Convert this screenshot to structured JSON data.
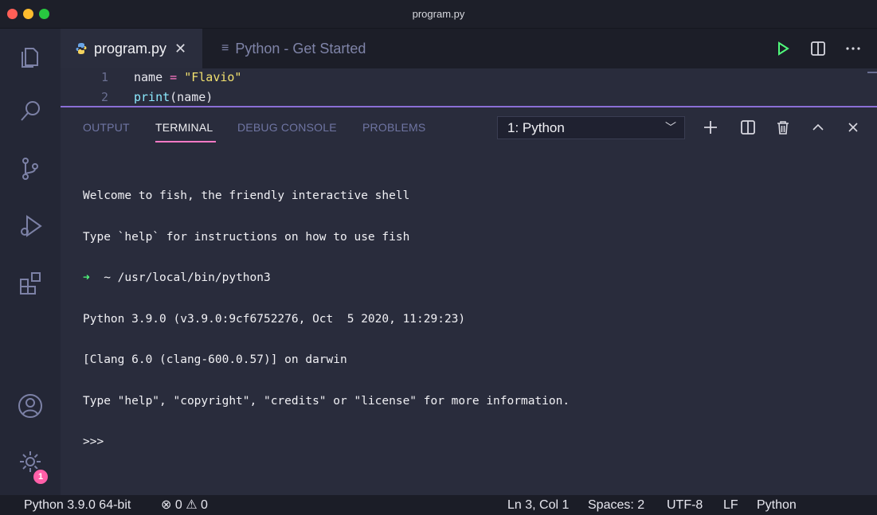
{
  "window": {
    "title": "program.py"
  },
  "tabs": {
    "active": {
      "label": "program.py",
      "close": "✕"
    },
    "inactive": {
      "icon": "≡",
      "label": "Python - Get Started"
    }
  },
  "editor": {
    "lines": [
      {
        "number": "1",
        "parts": [
          "name ",
          "= ",
          "\"Flavio\""
        ]
      },
      {
        "number": "2",
        "parts": [
          "print",
          "(name)"
        ]
      }
    ]
  },
  "panel": {
    "tabs": [
      "OUTPUT",
      "TERMINAL",
      "DEBUG CONSOLE",
      "PROBLEMS"
    ],
    "terminal_select": "1: Python",
    "terminal_lines": [
      "Welcome to fish, the friendly interactive shell",
      "Type `help` for instructions on how to use fish",
      "~ /usr/local/bin/python3",
      "Python 3.9.0 (v3.9.0:9cf6752276, Oct  5 2020, 11:29:23)",
      "[Clang 6.0 (clang-600.0.57)] on darwin",
      "Type \"help\", \"copyright\", \"credits\" or \"license\" for more information.",
      ">>>"
    ],
    "prompt_arrow": "➜"
  },
  "activity": {
    "settings_badge": "1"
  },
  "status": {
    "interpreter": "Python 3.9.0 64-bit",
    "problems": "⊗ 0 ⚠ 0",
    "position": "Ln 3, Col 1",
    "spaces": "Spaces: 2",
    "encoding": "UTF-8",
    "eol": "LF",
    "language": "Python"
  },
  "icons": {
    "explorer": "files-icon",
    "search": "search-icon",
    "scm": "source-control-icon",
    "debug": "run-debug-icon",
    "extensions": "extensions-icon",
    "accounts": "account-icon",
    "manage": "gear-icon",
    "run": "play-icon",
    "split": "split-editor-icon",
    "more": "more-icon",
    "add": "plus-icon",
    "trash": "trash-icon",
    "up": "chevron-up-icon",
    "close": "close-icon",
    "feedback": "feedback-icon",
    "bell": "bell-icon"
  },
  "colors": {
    "accent": "#ff79c6",
    "divider": "#8a6fd6",
    "badge": "#ff5fa8"
  }
}
